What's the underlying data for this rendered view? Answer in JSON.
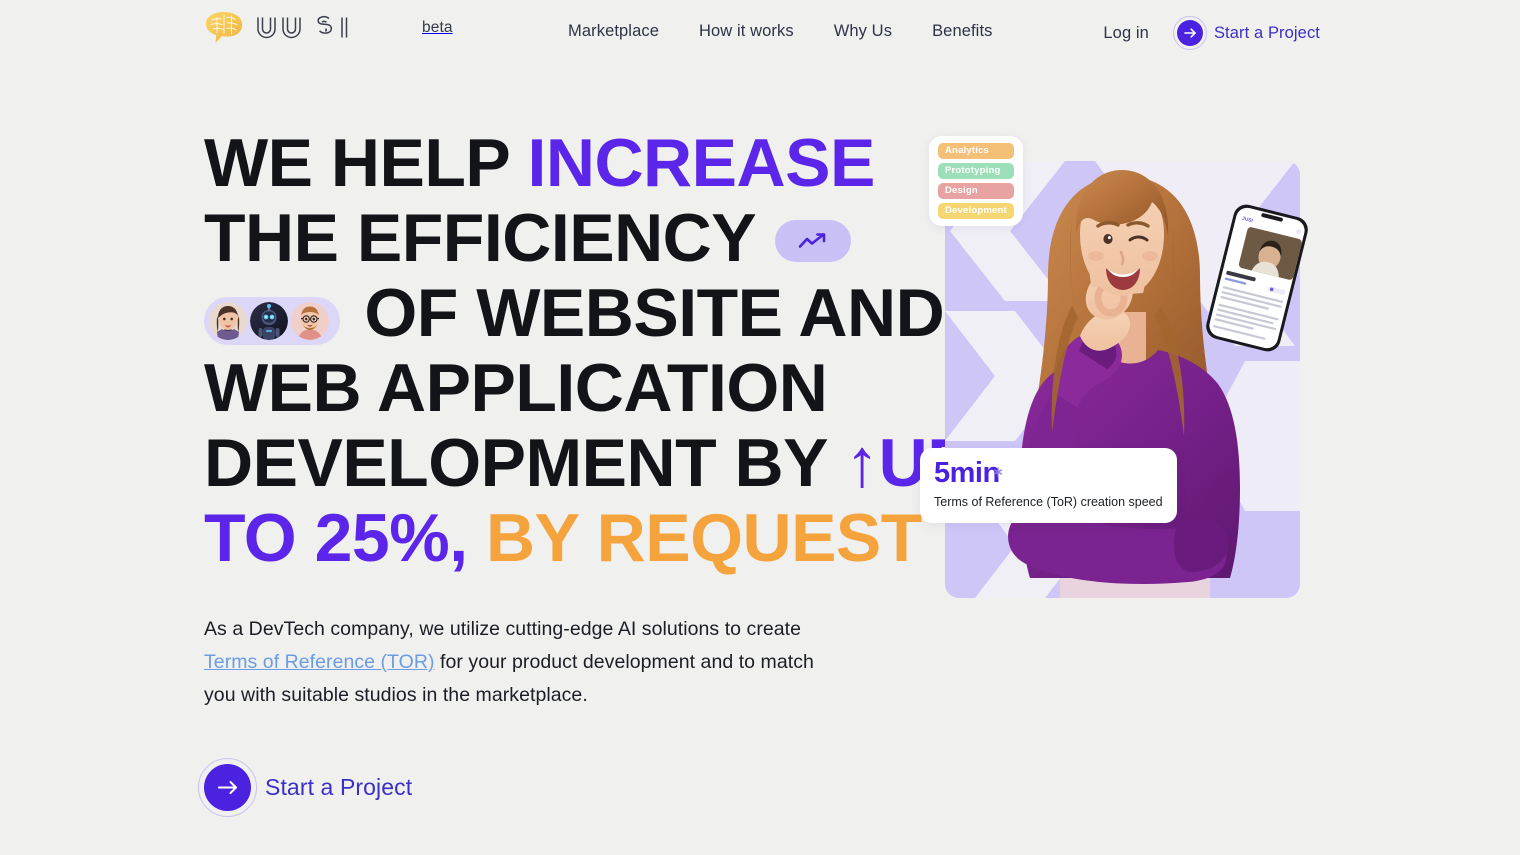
{
  "brand": {
    "logo_icon": "brain-icon",
    "wordmark": "JUSI",
    "beta_label": "beta"
  },
  "nav": {
    "items": [
      {
        "label": "Marketplace"
      },
      {
        "label": "How it works"
      },
      {
        "label": "Why Us"
      },
      {
        "label": "Benefits"
      }
    ]
  },
  "header_actions": {
    "login_label": "Log in",
    "cta_label": "Start a Project",
    "cta_icon": "arrow-right-icon"
  },
  "hero": {
    "headline": {
      "line1_a": "WE HELP ",
      "line1_b": "INCREASE",
      "line2_a": "THE EFFICIENCY ",
      "line3_a": " OF WEBSITE AND",
      "line4_a": "WEB APPLICATION",
      "line5_a": "DEVELOPMENT BY ",
      "line5_b": "↑UP",
      "line6_a": "TO 25%,",
      "line6_b": " BY REQUEST",
      "trend_icon": "trending-up-icon",
      "avatars": [
        {
          "name": "avatar-woman"
        },
        {
          "name": "avatar-robot"
        },
        {
          "name": "avatar-man"
        }
      ]
    },
    "lead": {
      "part1": "As a DevTech company, we utilize cutting-edge AI solutions to create ",
      "link": "Terms of Reference (TOR)",
      "part2": " for your product development and to match you with suitable studios in the marketplace."
    },
    "cta_label": "Start a Project",
    "cta_icon": "arrow-right-icon"
  },
  "art": {
    "tags": [
      {
        "label": "Analytics",
        "color": "#F4C078"
      },
      {
        "label": "Prototyping",
        "color": "#9DDFB8"
      },
      {
        "label": "Design",
        "color": "#E8A2A2"
      },
      {
        "label": "Development",
        "color": "#F5D670"
      }
    ],
    "stat": {
      "value": "5min",
      "description": "Terms of Reference (ToR) creation speed",
      "sparkle_icon": "sparkle-icon"
    },
    "phone": {
      "name": "phone-mockup"
    },
    "subject": {
      "name": "hero-photo-woman-ok-gesture"
    }
  },
  "colors": {
    "page_bg": "#F0F0EF",
    "ink": "#121417",
    "purple": "#5B26EA",
    "purple_deep": "#4B22E0",
    "orange": "#F5A33D",
    "link_blue": "#6C9CE2",
    "lavender": "#CFC6F8",
    "lavender_soft": "#C9C1F5"
  }
}
